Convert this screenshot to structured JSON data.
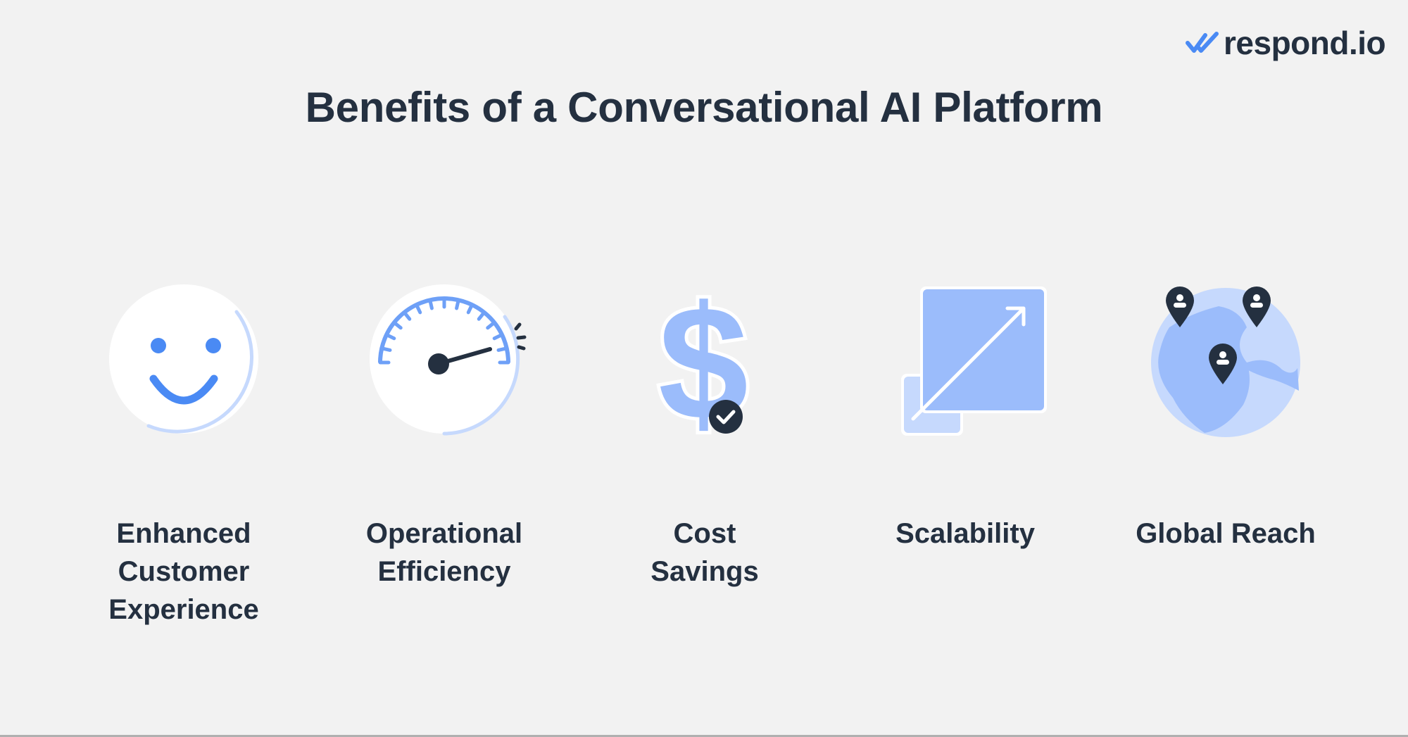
{
  "brand": {
    "name": "respond.io",
    "logo_icon": "double-check-icon"
  },
  "title": "Benefits of a Conversational AI Platform",
  "colors": {
    "background": "#f2f2f2",
    "text": "#243040",
    "accent_blue": "#4a8af4",
    "light_blue": "#9bbcfb",
    "pale_blue": "#c6d9fd"
  },
  "benefits": [
    {
      "label": "Enhanced\nCustomer\nExperience",
      "icon": "smiley-face-icon"
    },
    {
      "label": "Operational\nEfficiency",
      "icon": "speedometer-icon"
    },
    {
      "label": "Cost\nSavings",
      "icon": "dollar-check-icon"
    },
    {
      "label": "Scalability",
      "icon": "scale-up-arrow-icon"
    },
    {
      "label": "Global Reach",
      "icon": "globe-pins-icon"
    }
  ]
}
